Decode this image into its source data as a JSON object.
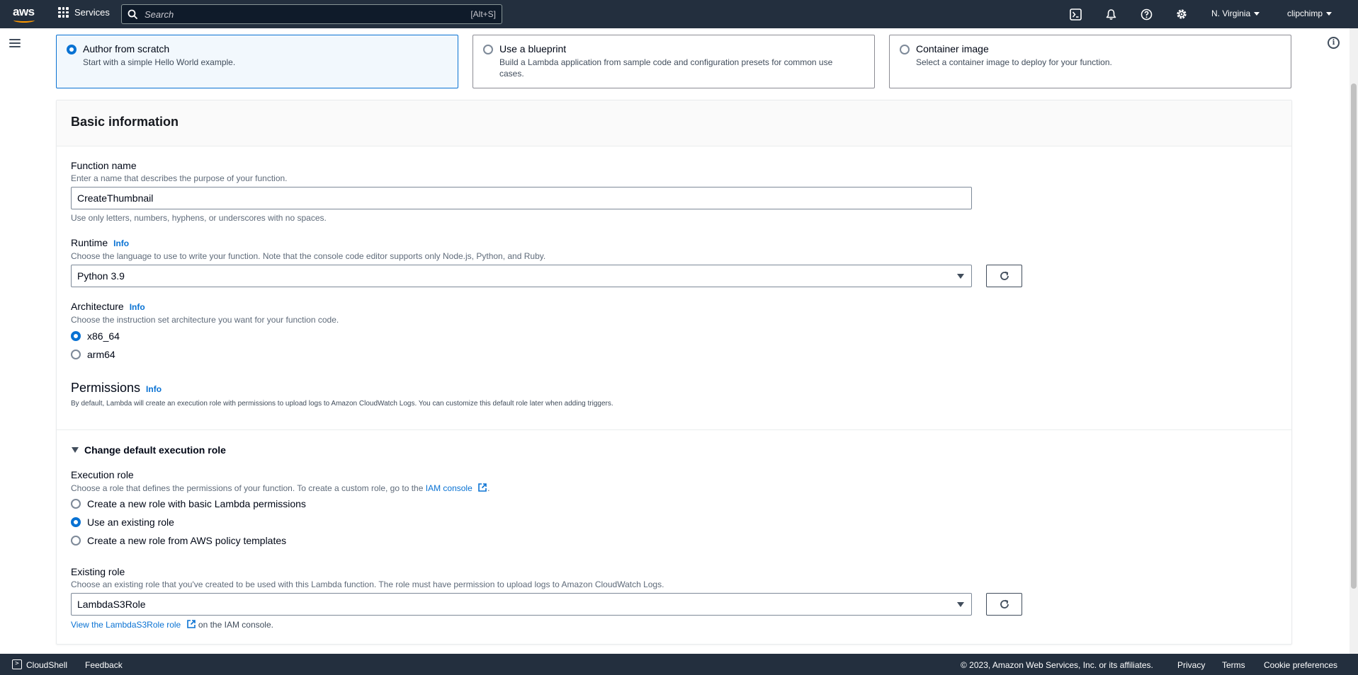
{
  "topnav": {
    "logo_text": "aws",
    "services_label": "Services",
    "search_placeholder": "Search",
    "search_shortcut": "[Alt+S]",
    "region": "N. Virginia",
    "account": "clipchimp",
    "icons": [
      "cloudshell-icon",
      "bell-icon",
      "help-icon",
      "settings-icon"
    ]
  },
  "options": [
    {
      "title": "Author from scratch",
      "description": "Start with a simple Hello World example.",
      "selected": true
    },
    {
      "title": "Use a blueprint",
      "description": "Build a Lambda application from sample code and configuration presets for common use cases.",
      "selected": false
    },
    {
      "title": "Container image",
      "description": "Select a container image to deploy for your function.",
      "selected": false
    }
  ],
  "basic": {
    "heading": "Basic information",
    "function_name": {
      "label": "Function name",
      "description": "Enter a name that describes the purpose of your function.",
      "value": "CreateThumbnail",
      "constraint": "Use only letters, numbers, hyphens, or underscores with no spaces."
    },
    "runtime": {
      "label": "Runtime",
      "info": "Info",
      "description": "Choose the language to use to write your function. Note that the console code editor supports only Node.js, Python, and Ruby.",
      "value": "Python 3.9"
    },
    "architecture": {
      "label": "Architecture",
      "info": "Info",
      "description": "Choose the instruction set architecture you want for your function code.",
      "options": [
        "x86_64",
        "arm64"
      ],
      "selected": "x86_64"
    },
    "permissions": {
      "label": "Permissions",
      "info": "Info",
      "description": "By default, Lambda will create an execution role with permissions to upload logs to Amazon CloudWatch Logs. You can customize this default role later when adding triggers."
    },
    "execution": {
      "expander": "Change default execution role",
      "label": "Execution role",
      "description_prefix": "Choose a role that defines the permissions of your function. To create a custom role, go to the",
      "iam_link": "IAM console",
      "period": ".",
      "options": [
        "Create a new role with basic Lambda permissions",
        "Use an existing role",
        "Create a new role from AWS policy templates"
      ],
      "selected": "Use an existing role"
    },
    "existing_role": {
      "label": "Existing role",
      "description": "Choose an existing role that you've created to be used with this Lambda function. The role must have permission to upload logs to Amazon CloudWatch Logs.",
      "value": "LambdaS3Role",
      "view_link": "View the LambdaS3Role role",
      "view_suffix": "on the IAM console."
    }
  },
  "footer": {
    "cloudshell": "CloudShell",
    "feedback": "Feedback",
    "copyright": "© 2023, Amazon Web Services, Inc. or its affiliates.",
    "privacy": "Privacy",
    "terms": "Terms",
    "cookies": "Cookie preferences"
  },
  "colors": {
    "nav_bg": "#232f3e",
    "accent": "#0972d3",
    "brand_orange": "#ff9900"
  }
}
